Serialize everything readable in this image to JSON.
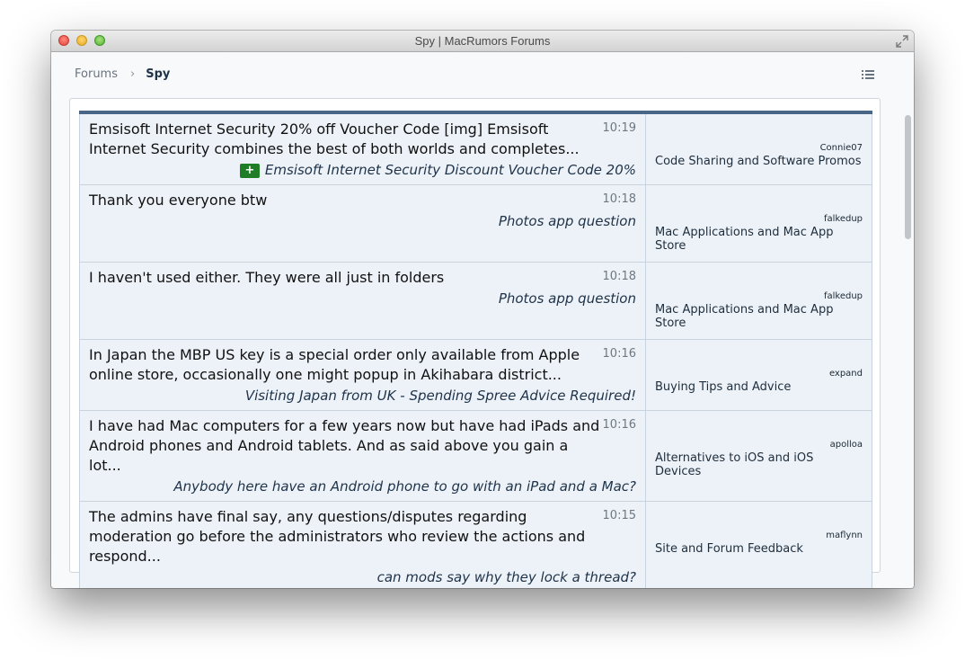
{
  "window": {
    "title": "Spy | MacRumors Forums"
  },
  "breadcrumb": {
    "parent": "Forums",
    "separator": "›",
    "current": "Spy"
  },
  "posts": [
    {
      "snippet": "Emsisoft Internet Security 20% off Voucher Code [img] Emsisoft Internet Security combines the best of both worlds and completes...",
      "time": "10:19",
      "thread": "Emsisoft Internet Security Discount Voucher Code 20%",
      "new_thread_badge": "+",
      "user": "Connie07",
      "forum": "Code Sharing and Software Promos"
    },
    {
      "snippet": "Thank you everyone btw",
      "time": "10:18",
      "thread": "Photos app question",
      "user": "falkedup",
      "forum": "Mac Applications and Mac App Store"
    },
    {
      "snippet": "I haven't used either. They were all just in folders",
      "time": "10:18",
      "thread": "Photos app question",
      "user": "falkedup",
      "forum": "Mac Applications and Mac App Store"
    },
    {
      "snippet": "In Japan the MBP US key is a special order only available from Apple online store, occasionally one might popup in Akihabara district...",
      "time": "10:16",
      "thread": "Visiting Japan from UK - Spending Spree Advice Required!",
      "user": "expand",
      "forum": "Buying Tips and Advice"
    },
    {
      "snippet": "I have had Mac computers for a few years now but have had iPads and Android phones and Android tablets. And as said above you gain a lot...",
      "time": "10:16",
      "thread": "Anybody here have an Android phone to go with an iPad and a Mac?",
      "user": "apolloa",
      "forum": "Alternatives to iOS and iOS Devices"
    },
    {
      "snippet": "The admins have final say, any questions/disputes regarding moderation go before the administrators who review the actions and respond...",
      "time": "10:15",
      "thread": "can mods say why they lock a thread?",
      "user": "maflynn",
      "forum": "Site and Forum Feedback"
    }
  ],
  "colors": {
    "header_bar": "#4a6687",
    "row_background": "#edf2f8",
    "new_badge": "#1f7d25"
  }
}
